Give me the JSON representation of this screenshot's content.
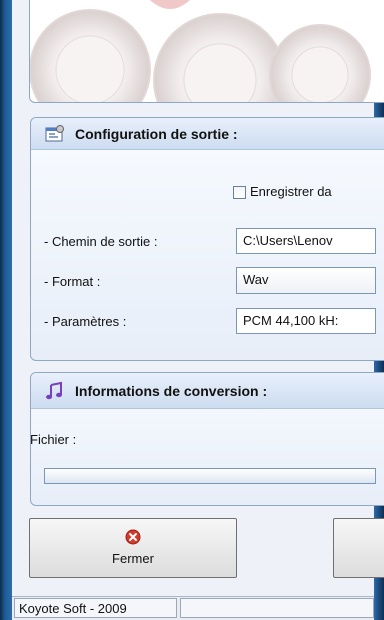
{
  "output_config": {
    "title": "Configuration de sortie :",
    "icon": "settings-window-icon",
    "record_label": "Enregistrer da",
    "record_checked": false,
    "path_label": "- Chemin de sortie :",
    "path_value": "C:\\Users\\Lenov",
    "format_label": "- Format :",
    "format_value": "Wav",
    "params_label": "- Paramètres :",
    "params_value": "PCM 44,100 kH:"
  },
  "conversion_info": {
    "title": "Informations de conversion :",
    "icon": "music-note-icon",
    "file_label": "Fichier :",
    "progress": 0
  },
  "buttons": {
    "close_label": "Fermer",
    "close_icon": "close-circle-icon"
  },
  "status_bar": {
    "text": "Koyote Soft - 2009"
  },
  "colors": {
    "accent": "#1e5a92",
    "header_bg": "#cddcf0",
    "close_red": "#d23a2a"
  }
}
